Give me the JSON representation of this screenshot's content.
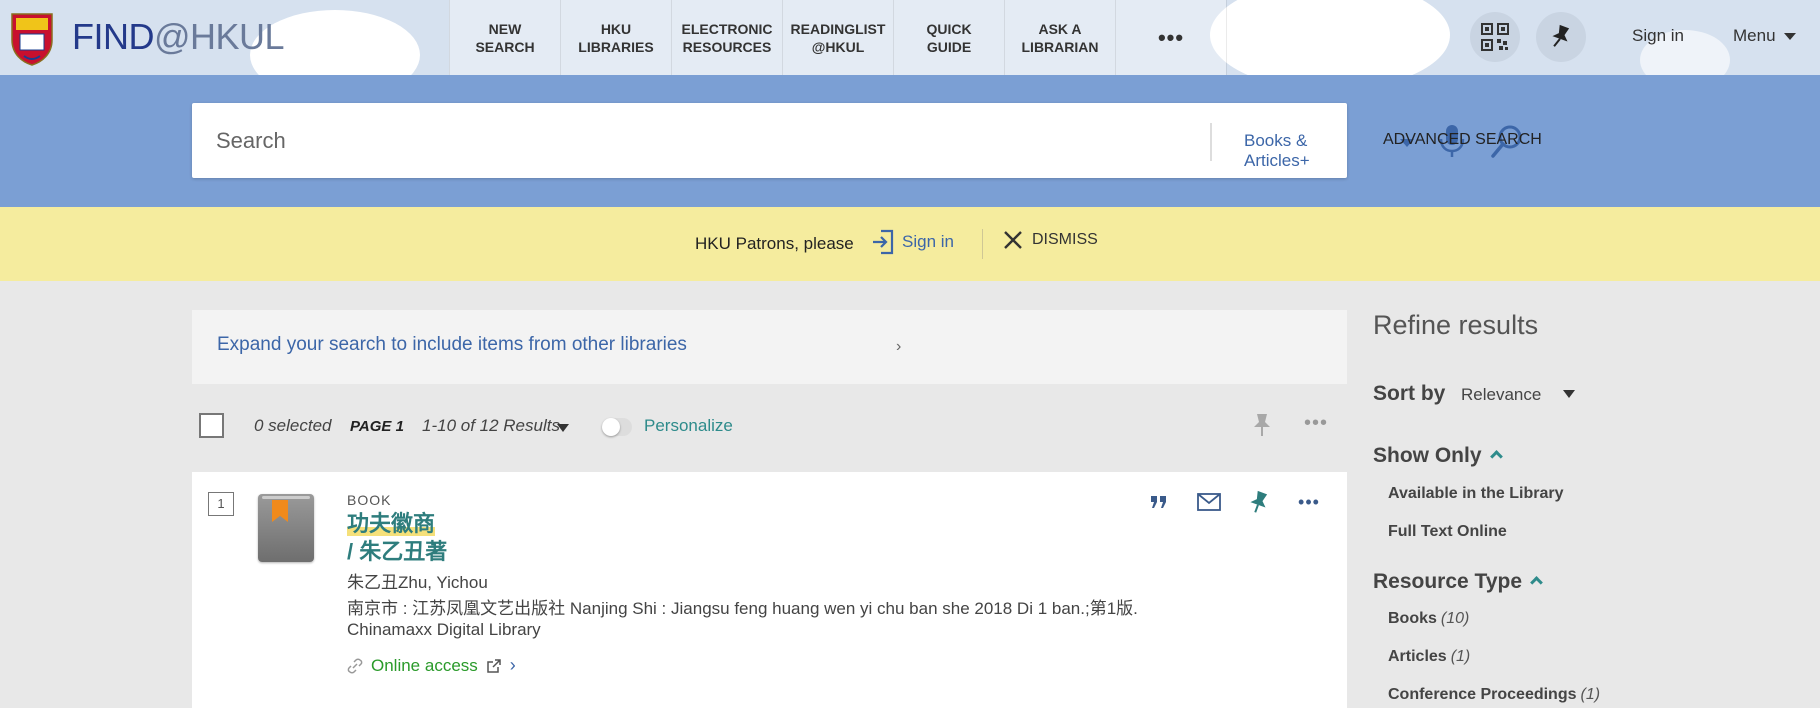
{
  "header": {
    "logo_main": "FIND",
    "logo_suffix": "@HKUL",
    "nav": [
      {
        "line1": "NEW",
        "line2": "SEARCH"
      },
      {
        "line1": "HKU",
        "line2": "LIBRARIES"
      },
      {
        "line1": "ELECTRONIC",
        "line2": "RESOURCES"
      },
      {
        "line1": "READINGLIST",
        "line2": "@HKUL"
      },
      {
        "line1": "QUICK",
        "line2": "GUIDE"
      },
      {
        "line1": "ASK A",
        "line2": "LIBRARIAN"
      }
    ],
    "more_label": "•••",
    "sign_in": "Sign in",
    "menu": "Menu"
  },
  "search": {
    "placeholder": "Search",
    "scope": "Books & Articles+",
    "advanced": "ADVANCED SEARCH"
  },
  "notice": {
    "text": "HKU Patrons, please",
    "sign_in": "Sign in",
    "dismiss": "DISMISS"
  },
  "expand": {
    "link": "Expand your search to include items from other libraries"
  },
  "toolbar": {
    "selected": "0 selected",
    "page": "PAGE 1",
    "results": "1-10 of 12 Results",
    "personalize": "Personalize"
  },
  "results": [
    {
      "number": "1",
      "type": "BOOK",
      "title": "功夫徽商",
      "subtitle": "/ 朱乙丑著",
      "author": "朱乙丑Zhu, Yichou",
      "publication": "南京市 : 江苏凤凰文艺出版社  Nanjing Shi : Jiangsu feng huang wen yi chu ban she  2018  Di 1 ban.;第1版.",
      "collection": "Chinamaxx Digital Library",
      "access": "Online access"
    }
  ],
  "sidebar": {
    "title": "Refine results",
    "sort_label": "Sort by",
    "sort_value": "Relevance",
    "show_only": {
      "title": "Show Only",
      "items": [
        "Available in the Library",
        "Full Text Online"
      ]
    },
    "resource_type": {
      "title": "Resource Type",
      "items": [
        {
          "label": "Books",
          "count": "(10)"
        },
        {
          "label": "Articles",
          "count": "(1)"
        },
        {
          "label": "Conference Proceedings",
          "count": "(1)"
        }
      ]
    }
  },
  "colors": {
    "search_band": "#7b9fd4",
    "notice": "#f5ec9e",
    "link": "#3c66a8",
    "teal": "#2e7d7d",
    "online_access": "#2a9a2a"
  }
}
